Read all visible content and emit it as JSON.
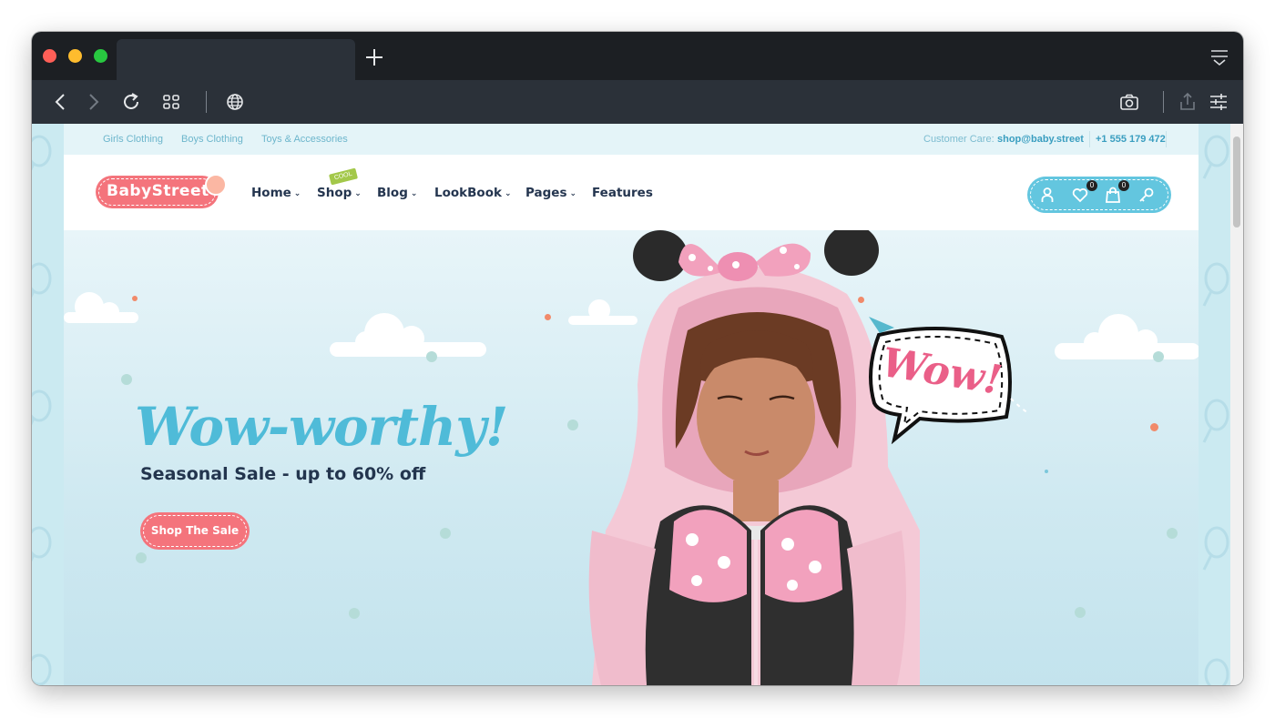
{
  "browser": {
    "new_tab_icon": "plus-icon",
    "tab_menu_icon": "tab-list-icon",
    "toolbar_icons": [
      "back-icon",
      "forward-icon",
      "reload-icon",
      "grid-icon",
      "globe-icon",
      "camera-icon",
      "share-icon",
      "settings-sliders-icon"
    ]
  },
  "topbar": {
    "links": [
      "Girls Clothing",
      "Boys Clothing",
      "Toys & Accessories"
    ],
    "care_label": "Customer Care:",
    "care_email": "shop@baby.street",
    "care_phone": "+1 555 179 472"
  },
  "header": {
    "logo_text": "BabyStreet",
    "nav": [
      {
        "label": "Home",
        "has_dropdown": true
      },
      {
        "label": "Shop",
        "has_dropdown": true,
        "badge": "COOL"
      },
      {
        "label": "Blog",
        "has_dropdown": true
      },
      {
        "label": "LookBook",
        "has_dropdown": true
      },
      {
        "label": "Pages",
        "has_dropdown": true
      },
      {
        "label": "Features",
        "has_dropdown": false
      }
    ],
    "wishlist_count": "0",
    "cart_count": "0",
    "icons": [
      "user-icon",
      "heart-icon",
      "bag-icon",
      "key-icon"
    ]
  },
  "hero": {
    "headline": "Wow-worthy!",
    "subheadline": "Seasonal Sale - up to 60% off",
    "cta_label": "Shop The Sale",
    "bubble_text": "Wow!"
  },
  "colors": {
    "brand_pink": "#f4747c",
    "brand_blue": "#4fbbd8",
    "nav_text": "#24354f",
    "cool_badge": "#a3c84a"
  }
}
